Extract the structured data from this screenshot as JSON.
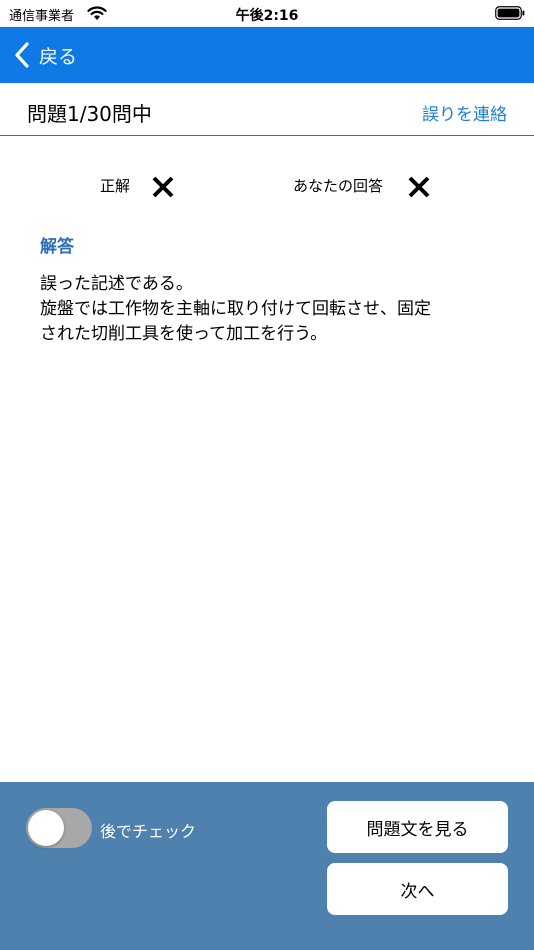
{
  "status_bar": {
    "carrier": "通信事業者",
    "time": "午後2:16"
  },
  "nav": {
    "back_label": "戻る"
  },
  "question_header": {
    "counter": "問題1/30問中",
    "report_link": "誤りを連絡"
  },
  "result": {
    "correct_label": "正解",
    "correct_icon": "cross-icon",
    "your_answer_label": "あなたの回答",
    "your_answer_icon": "cross-icon"
  },
  "answer": {
    "heading": "解答",
    "lines": [
      "誤った記述である。",
      "旋盤では工作物を主軸に取り付けて回転させ、固定",
      "された切削工具を使って加工を行う。"
    ]
  },
  "footer": {
    "check_later_label": "後でチェック",
    "check_later_on": false,
    "view_question_button": "問題文を見る",
    "next_button": "次へ"
  },
  "colors": {
    "nav_blue": "#0f7ae5",
    "link_blue": "#1a7fd9",
    "heading_blue": "#2f6fb4",
    "footer_blue": "#4f81ae",
    "toggle_off": "#a8a8a8"
  }
}
